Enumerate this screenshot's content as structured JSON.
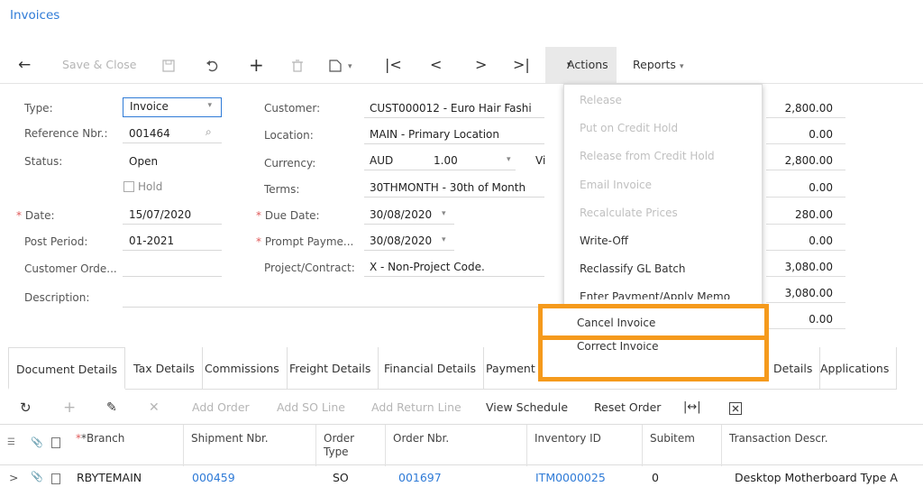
{
  "page": {
    "title": "Invoices"
  },
  "toolbar": {
    "back_icon": "arrow-left-icon",
    "save_close": "Save & Close",
    "actions": "Actions",
    "actions_caret": "▾",
    "reports": "Reports",
    "reports_caret": "▾"
  },
  "form": {
    "type_label": "Type:",
    "type_value": "Invoice",
    "ref_label": "Reference Nbr.:",
    "ref_value": "001464",
    "status_label": "Status:",
    "status_value": "Open",
    "hold_label": "Hold",
    "date_label": "Date:",
    "date_value": "15/07/2020",
    "post_period_label": "Post Period:",
    "post_period_value": "01-2021",
    "customer_order_label": "Customer Orde...",
    "description_label": "Description:",
    "customer_label": "Customer:",
    "customer_value": "CUST000012 - Euro Hair Fashi",
    "location_label": "Location:",
    "location_value": "MAIN - Primary Location",
    "currency_label": "Currency:",
    "currency_value": "AUD",
    "currency_rate": "1.00",
    "currency_extra": "Vi",
    "terms_label": "Terms:",
    "terms_value": "30THMONTH - 30th of Month",
    "due_date_label": "Due Date:",
    "due_date_value": "30/08/2020",
    "prompt_label": "Prompt Payme...",
    "prompt_value": "30/08/2020",
    "project_label": "Project/Contract:",
    "project_value": "X - Non-Project Code."
  },
  "summary": [
    "2,800.00",
    "0.00",
    "2,800.00",
    "0.00",
    "280.00",
    "0.00",
    "3,080.00",
    "3,080.00",
    "0.00"
  ],
  "actions_menu": [
    {
      "label": "Release",
      "enabled": false
    },
    {
      "label": "Put on Credit Hold",
      "enabled": false
    },
    {
      "label": "Release from Credit Hold",
      "enabled": false
    },
    {
      "label": "Email Invoice",
      "enabled": false
    },
    {
      "label": "Recalculate Prices",
      "enabled": false
    },
    {
      "label": "Write-Off",
      "enabled": true
    },
    {
      "label": "Reclassify GL Batch",
      "enabled": true
    },
    {
      "label": "Enter Payment/Apply Memo",
      "enabled": true
    },
    {
      "label": "Cancel Invoice",
      "enabled": true
    },
    {
      "label": "Correct Invoice",
      "enabled": true
    }
  ],
  "tabs": [
    "Document Details",
    "Tax Details",
    "Commissions",
    "Freight Details",
    "Financial Details",
    "Payment",
    "Details",
    "Applications"
  ],
  "grid_toolbar": {
    "add_order": "Add Order",
    "add_so_line": "Add SO Line",
    "add_return_line": "Add Return Line",
    "view_schedule": "View Schedule",
    "reset_order": "Reset Order"
  },
  "grid": {
    "columns": [
      "*Branch",
      "Shipment Nbr.",
      "Order Type",
      "Order Nbr.",
      "Inventory ID",
      "Subitem",
      "Transaction Descr."
    ],
    "rows": [
      [
        "RBYTEMAIN",
        "000459",
        "SO",
        "001697",
        "ITM0000025",
        "0",
        "Desktop Motherboard Type A"
      ]
    ]
  },
  "colors": {
    "accent": "#2f7bd7",
    "highlight": "#f59a1c"
  }
}
